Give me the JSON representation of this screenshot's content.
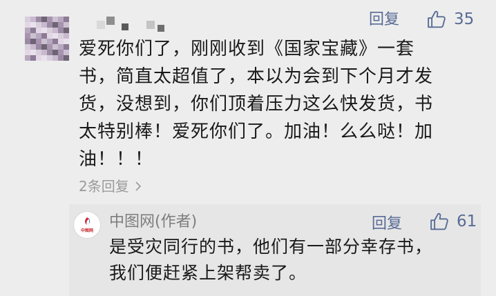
{
  "comment": {
    "reply_label": "回复",
    "likes": "35",
    "text_lines": [
      "爱死你们了，刚刚收到《国家宝藏》一套",
      "书，简直太超值了，本以为会到下个月才发",
      "货，没想到，你们顶着压力这么快发货，书",
      "太特别棒！爱死你们了。加油！么么哒！加",
      "油！！！"
    ],
    "replies_count_label": "2条回复"
  },
  "author_reply": {
    "author_name": "中图网(作者)",
    "logo_text": "中图网",
    "reply_label": "回复",
    "likes": "61",
    "text_lines": [
      "是受灾同行的书，他们有一部分幸存书，",
      "我们便赶紧上架帮卖了。"
    ]
  },
  "colors": {
    "link": "#576b95",
    "muted": "#9a9a9a",
    "background": "#ededed",
    "reply_background": "#e6e6e6",
    "logo_red": "#c7282e",
    "logo_blue": "#1c3f94"
  },
  "icons": {
    "like": "thumbs-up-icon",
    "chevron": "chevron-right-icon"
  }
}
